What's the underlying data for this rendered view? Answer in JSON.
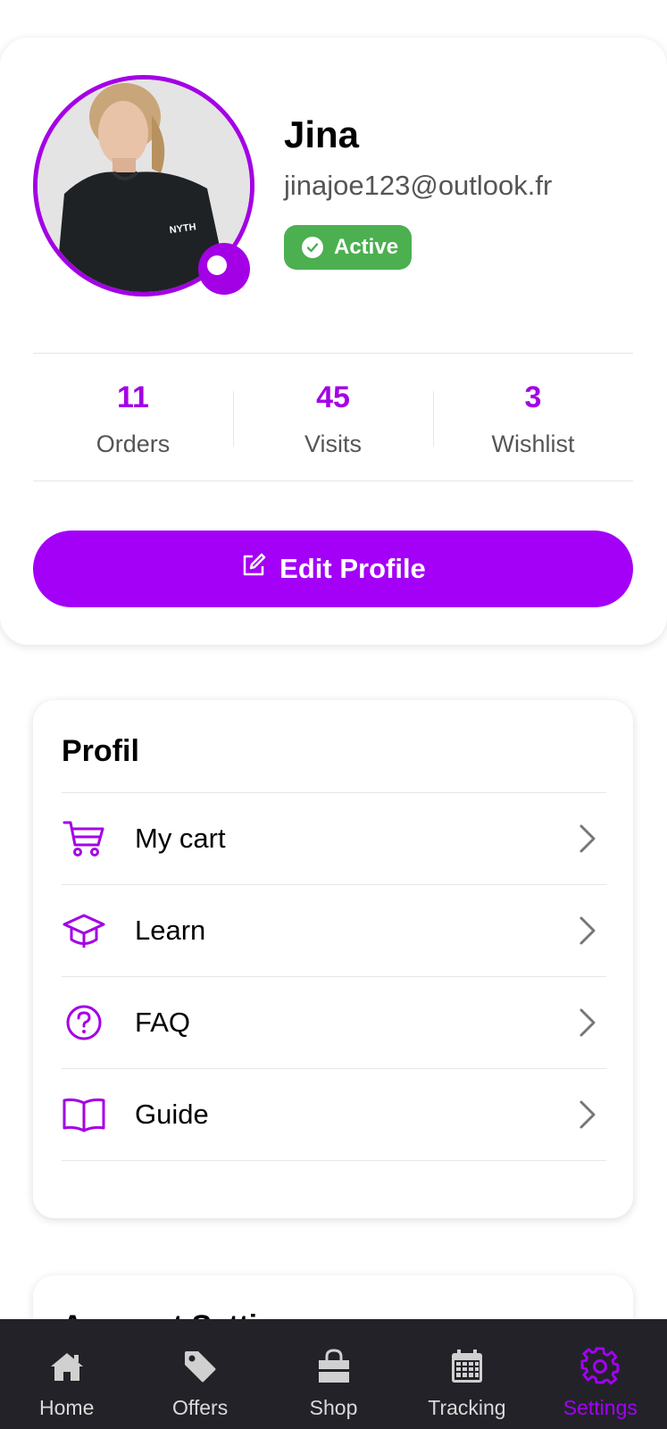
{
  "user": {
    "name": "Jina",
    "email": "jinajoe123@outlook.fr",
    "status": "Active",
    "shirt_text": "NYTH"
  },
  "stats": [
    {
      "value": "11",
      "label": "Orders"
    },
    {
      "value": "45",
      "label": "Visits"
    },
    {
      "value": "3",
      "label": "Wishlist"
    }
  ],
  "edit_button_label": "Edit Profile",
  "profile_menu": {
    "title": "Profil",
    "items": [
      {
        "label": "My cart",
        "icon": "cart-icon"
      },
      {
        "label": "Learn",
        "icon": "graduation-cap-icon"
      },
      {
        "label": "FAQ",
        "icon": "question-circle-icon"
      },
      {
        "label": "Guide",
        "icon": "book-icon"
      }
    ]
  },
  "next_section_title": "Account Settings",
  "nav": {
    "items": [
      {
        "label": "Home",
        "icon": "home-icon"
      },
      {
        "label": "Offers",
        "icon": "tag-icon"
      },
      {
        "label": "Shop",
        "icon": "shopping-bag-icon"
      },
      {
        "label": "Tracking",
        "icon": "calendar-icon"
      },
      {
        "label": "Settings",
        "icon": "gear-icon"
      }
    ],
    "active": "Settings"
  },
  "colors": {
    "accent": "#a400f7",
    "status_green": "#4caf50",
    "nav_background": "#232229"
  }
}
